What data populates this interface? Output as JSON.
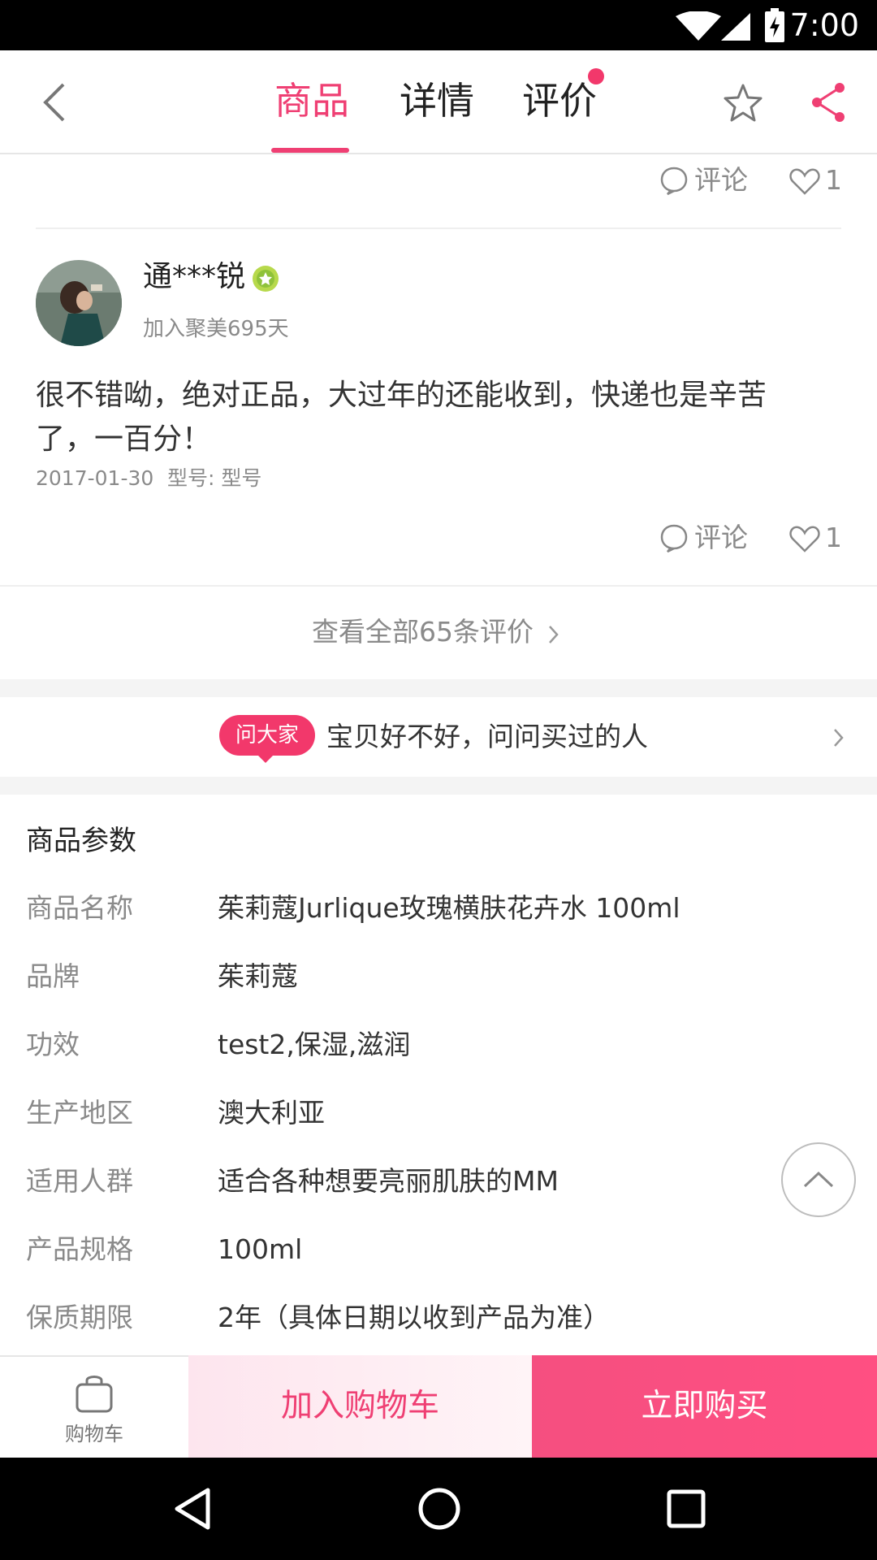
{
  "status_bar": {
    "time": "7:00"
  },
  "header": {
    "tabs": [
      {
        "label": "商品",
        "active": true
      },
      {
        "label": "详情",
        "active": false
      },
      {
        "label": "评价",
        "active": false,
        "has_dot": true
      }
    ],
    "accent_color": "#ef3f73"
  },
  "review_prev": {
    "comment_label": "评论",
    "like_count": "1"
  },
  "review": {
    "username": "通***锐",
    "join_info": "加入聚美695天",
    "content_line1": "很不错呦，绝对正品，大过年的还能收到，快递也是辛苦",
    "content_line2": "了，一百分！",
    "date": "2017-01-30",
    "model": "型号: 型号",
    "comment_label": "评论",
    "like_count": "1"
  },
  "view_all": {
    "label": "查看全部65条评价"
  },
  "ask": {
    "badge": "问大家",
    "text": "宝贝好不好，问问买过的人"
  },
  "params": {
    "title": "商品参数",
    "rows": [
      {
        "label": "商品名称",
        "value": "茱莉蔻Jurlique玫瑰横肤花卉水 100ml"
      },
      {
        "label": "品牌",
        "value": "茱莉蔻"
      },
      {
        "label": "功效",
        "value": "test2,保湿,滋润"
      },
      {
        "label": "生产地区",
        "value": "澳大利亚"
      },
      {
        "label": "适用人群",
        "value": "适合各种想要亮丽肌肤的MM"
      },
      {
        "label": "产品规格",
        "value": "100ml"
      },
      {
        "label": "保质期限",
        "value": "2年（具体日期以收到产品为准）"
      }
    ]
  },
  "bottom_bar": {
    "cart_label": "购物车",
    "add_to_cart": "加入购物车",
    "buy_now": "立即购买"
  }
}
